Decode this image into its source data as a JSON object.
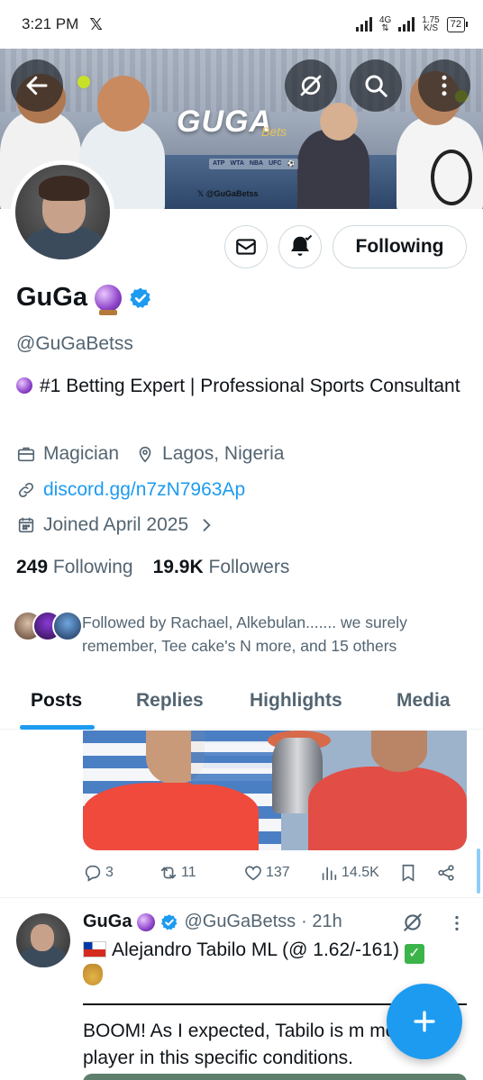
{
  "status_bar": {
    "time": "3:21 PM",
    "app_icon": "x-logo",
    "network": "4G",
    "speed_value": "1.75",
    "speed_unit": "K/S",
    "battery": "72"
  },
  "banner": {
    "logo_text": "GUGA",
    "logo_script": "Bets",
    "tours": [
      "ATP",
      "WTA",
      "NBA",
      "UFC",
      "⚽"
    ],
    "handle": "𝕏 @GuGaBetss"
  },
  "header_buttons": {
    "back_icon": "arrow-left-icon",
    "grok_icon": "grok-icon",
    "search_icon": "search-icon",
    "more_icon": "more-vertical-icon"
  },
  "profile": {
    "follow_button_label": "Following",
    "display_name": "GuGa",
    "handle": "@GuGaBetss",
    "bio": "#1 Betting Expert | Professional Sports Consultant",
    "profession": "Magician",
    "location": "Lagos, Nigeria",
    "link": "discord.gg/n7zN7963Ap",
    "joined": "Joined April 2025",
    "following_count": "249",
    "following_label": "Following",
    "followers_count": "19.9K",
    "followers_label": "Followers",
    "followed_by": "Followed by Rachael, Alkebulan....... we surely remember, Tee cake's N more, and 15 others"
  },
  "tabs": [
    {
      "label": "Posts",
      "active": true
    },
    {
      "label": "Replies",
      "active": false
    },
    {
      "label": "Highlights",
      "active": false
    },
    {
      "label": "Media",
      "active": false
    }
  ],
  "first_post_actions": {
    "replies": "3",
    "reposts": "11",
    "likes": "137",
    "views": "14.5K"
  },
  "second_post": {
    "author": "GuGa",
    "handle": "@GuGaBetss",
    "time": "· 21h",
    "line1": "Alejandro Tabilo ML (@ 1.62/-161)",
    "body": "BOOM! As I expected, Tabilo is more player in this specific conditions.",
    "body_visible": "BOOM! As I expected, Tabilo is m more player in this specific conditions."
  },
  "colors": {
    "accent": "#1d9bf0",
    "text_primary": "#0f1419",
    "text_secondary": "#536471"
  }
}
